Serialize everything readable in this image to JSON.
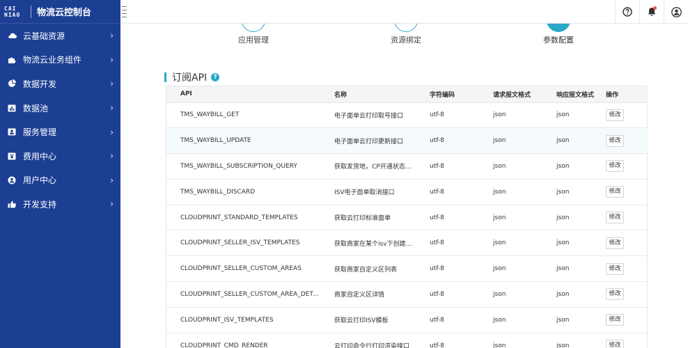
{
  "brand": {
    "logo_line1": "CAI",
    "logo_line2": "NIAO",
    "title": "物流云控制台"
  },
  "sidebar": {
    "items": [
      {
        "label": "云基础资源",
        "icon": "cloud-icon"
      },
      {
        "label": "物流云业务组件",
        "icon": "puzzle-icon"
      },
      {
        "label": "数据开发",
        "icon": "pie-chart-icon"
      },
      {
        "label": "数据池",
        "icon": "database-icon"
      },
      {
        "label": "服务管理",
        "icon": "id-card-icon"
      },
      {
        "label": "费用中心",
        "icon": "yen-icon"
      },
      {
        "label": "用户中心",
        "icon": "user-icon"
      },
      {
        "label": "开发支持",
        "icon": "thumbs-up-icon"
      }
    ]
  },
  "topbar": {
    "icons": [
      "help-icon",
      "bell-icon",
      "user-avatar-icon"
    ]
  },
  "steps": [
    {
      "label": "应用管理",
      "active": false
    },
    {
      "label": "资源绑定",
      "active": false
    },
    {
      "label": "参数配置",
      "active": true
    }
  ],
  "section": {
    "title": "订阅API",
    "help": "?"
  },
  "table": {
    "headers": [
      "API",
      "名称",
      "字符编码",
      "请求报文格式",
      "响应报文格式",
      "操作"
    ],
    "rows": [
      {
        "api": "TMS_WAYBILL_GET",
        "name": "电子面单云打印取号接口",
        "encoding": "utf-8",
        "req": "json",
        "resp": "json",
        "action": "修改"
      },
      {
        "api": "TMS_WAYBILL_UPDATE",
        "name": "电子面单云打印更新接口",
        "encoding": "utf-8",
        "req": "json",
        "resp": "json",
        "action": "修改"
      },
      {
        "api": "TMS_WAYBILL_SUBSCRIPTION_QUERY",
        "name": "获取发货地，CP开通状态…",
        "encoding": "utf-8",
        "req": "json",
        "resp": "json",
        "action": "修改"
      },
      {
        "api": "TMS_WAYBILL_DISCARD",
        "name": "ISV电子面单取消接口",
        "encoding": "utf-8",
        "req": "json",
        "resp": "json",
        "action": "修改"
      },
      {
        "api": "CLOUDPRINT_STANDARD_TEMPLATES",
        "name": "获取云打印标准面单",
        "encoding": "utf-8",
        "req": "json",
        "resp": "json",
        "action": "修改"
      },
      {
        "api": "CLOUDPRINT_SELLER_ISV_TEMPLATES",
        "name": "获取商家在某个isv下创建…",
        "encoding": "utf-8",
        "req": "json",
        "resp": "json",
        "action": "修改"
      },
      {
        "api": "CLOUDPRINT_SELLER_CUSTOM_AREAS",
        "name": "获取商家自定义区列表",
        "encoding": "utf-8",
        "req": "json",
        "resp": "json",
        "action": "修改"
      },
      {
        "api": "CLOUDPRINT_SELLER_CUSTOM_AREA_DETAIL",
        "name": "商家自定义区详情",
        "encoding": "utf-8",
        "req": "json",
        "resp": "json",
        "action": "修改"
      },
      {
        "api": "CLOUDPRINT_ISV_TEMPLATES",
        "name": "获取云打印ISV模板",
        "encoding": "utf-8",
        "req": "json",
        "resp": "json",
        "action": "修改"
      },
      {
        "api": "CLOUDPRINT_CMD_RENDER",
        "name": "云打印命令行打印渲染接口",
        "encoding": "utf-8",
        "req": "json",
        "resp": "json",
        "action": "修改"
      }
    ]
  },
  "colors": {
    "sidebar": "#1c3f94",
    "accent": "#2aa7c9"
  }
}
